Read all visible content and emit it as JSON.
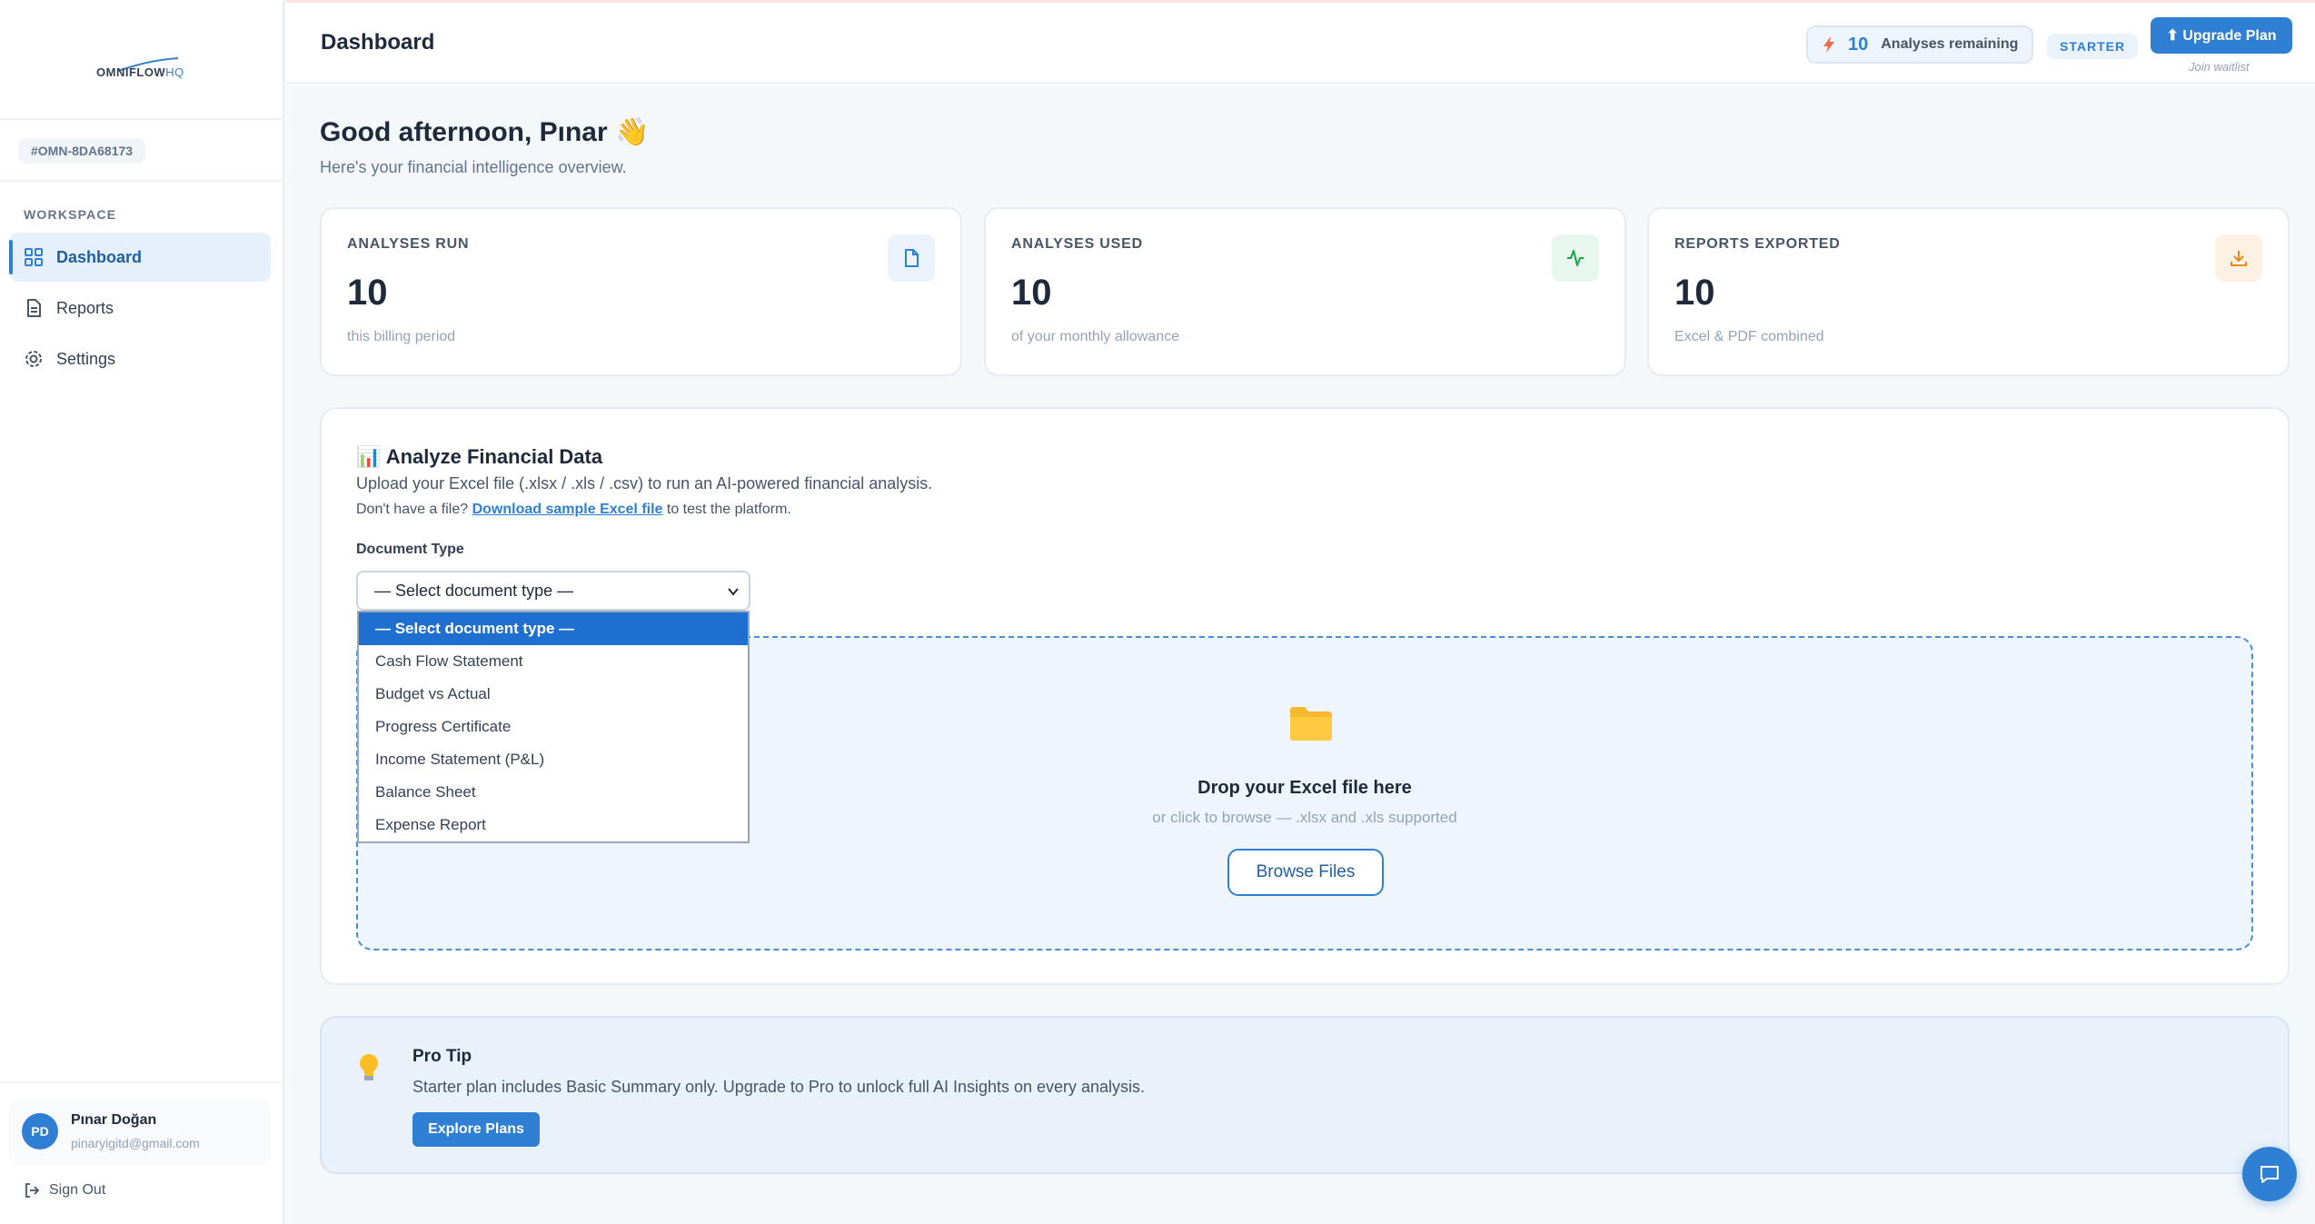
{
  "brand": {
    "name": "OMNIFLOW",
    "suffix": "HQ"
  },
  "sidebar": {
    "org_id": "#OMN-8DA68173",
    "section_label": "WORKSPACE",
    "items": [
      {
        "label": "Dashboard",
        "icon": "grid-icon",
        "active": true
      },
      {
        "label": "Reports",
        "icon": "document-icon",
        "active": false
      },
      {
        "label": "Settings",
        "icon": "gear-icon",
        "active": false
      }
    ],
    "user": {
      "initials": "PD",
      "name": "Pınar Doğan",
      "email": "pinaryigitd@gmail.com"
    },
    "sign_out": "Sign Out"
  },
  "header": {
    "title": "Dashboard",
    "remaining_count": "10",
    "remaining_label": "Analyses remaining",
    "plan": "STARTER",
    "upgrade_label": "⬆ Upgrade Plan",
    "waitlist": "Join waitlist"
  },
  "greeting": {
    "title": "Good afternoon, Pınar 👋",
    "subtitle": "Here's your financial intelligence overview."
  },
  "stats": [
    {
      "label": "ANALYSES RUN",
      "value": "10",
      "sub": "this billing period",
      "icon": "file-icon",
      "color": "#2f80d4",
      "bg": "#eaf2fc"
    },
    {
      "label": "ANALYSES USED",
      "value": "10",
      "sub": "of your monthly allowance",
      "icon": "activity-icon",
      "color": "#16a34a",
      "bg": "#e7f7ee"
    },
    {
      "label": "REPORTS EXPORTED",
      "value": "10",
      "sub": "Excel & PDF combined",
      "icon": "download-icon",
      "color": "#ea8a1a",
      "bg": "#fdf1e3"
    }
  ],
  "analyze": {
    "title": "📊 Analyze Financial Data",
    "description": "Upload your Excel file (.xlsx / .xls / .csv) to run an AI-powered financial analysis.",
    "sample_prefix": "Don't have a file?",
    "sample_link": "Download sample Excel file",
    "sample_suffix": "to test the platform.",
    "doc_type_label": "Document Type",
    "select_value": "— Select document type —",
    "options": [
      "— Select document type —",
      "Cash Flow Statement",
      "Budget vs Actual",
      "Progress Certificate",
      "Income Statement (P&L)",
      "Balance Sheet",
      "Expense Report"
    ],
    "drop_title": "Drop your Excel file here",
    "drop_sub": "or click to browse — .xlsx and .xls supported",
    "browse_label": "Browse Files"
  },
  "protip": {
    "title": "Pro Tip",
    "text": "Starter plan includes Basic Summary only. Upgrade to Pro to unlock full AI Insights on every analysis.",
    "button": "Explore Plans"
  }
}
